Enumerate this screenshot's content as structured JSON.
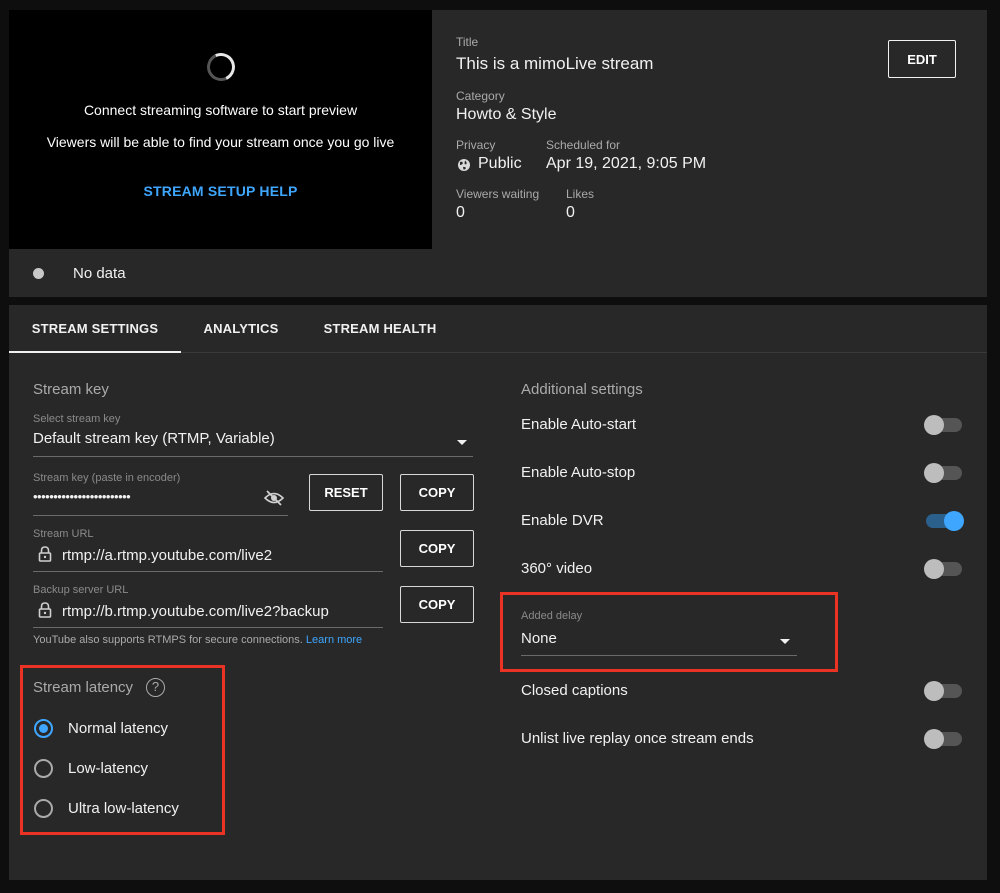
{
  "preview": {
    "line1": "Connect streaming software to start preview",
    "line2": "Viewers will be able to find your stream once you go live",
    "setup_help": "STREAM SETUP HELP",
    "status": "No data"
  },
  "details": {
    "title_label": "Title",
    "title": "This is a mimoLive stream",
    "edit_label": "EDIT",
    "category_label": "Category",
    "category": "Howto & Style",
    "privacy_label": "Privacy",
    "privacy": "Public",
    "privacy_icon": "globe-icon",
    "scheduled_label": "Scheduled for",
    "scheduled": "Apr 19, 2021, 9:05 PM",
    "viewers_label": "Viewers waiting",
    "viewers": "0",
    "likes_label": "Likes",
    "likes": "0"
  },
  "tabs": [
    {
      "label": "STREAM SETTINGS",
      "active": true
    },
    {
      "label": "ANALYTICS",
      "active": false
    },
    {
      "label": "STREAM HEALTH",
      "active": false
    }
  ],
  "stream_key": {
    "title": "Stream key",
    "select_label": "Select stream key",
    "select_value": "Default stream key (RTMP, Variable)",
    "key_label": "Stream key (paste in encoder)",
    "key_value": "••••••••••••••••••••••••",
    "reset_label": "RESET",
    "copy_label": "COPY",
    "url_label": "Stream URL",
    "url_value": "rtmp://a.rtmp.youtube.com/live2",
    "backup_label": "Backup server URL",
    "backup_value": "rtmp://b.rtmp.youtube.com/live2?backup",
    "note": "YouTube also supports RTMPS for secure connections.",
    "learn_more": "Learn more"
  },
  "latency": {
    "title": "Stream latency",
    "help": "?",
    "options": [
      {
        "label": "Normal latency",
        "selected": true
      },
      {
        "label": "Low-latency",
        "selected": false
      },
      {
        "label": "Ultra low-latency",
        "selected": false
      }
    ]
  },
  "additional": {
    "title": "Additional settings",
    "toggles": [
      {
        "label": "Enable Auto-start",
        "on": false
      },
      {
        "label": "Enable Auto-stop",
        "on": false
      },
      {
        "label": "Enable DVR",
        "on": true
      },
      {
        "label": "360° video",
        "on": false
      },
      {
        "label": "Closed captions",
        "on": false
      },
      {
        "label": "Unlist live replay once stream ends",
        "on": false
      }
    ],
    "delay_label": "Added delay",
    "delay_value": "None"
  },
  "colors": {
    "accent": "#3ea6ff",
    "highlight_box": "#ea3323",
    "panel": "#282828",
    "background": "#0e0e0e"
  }
}
